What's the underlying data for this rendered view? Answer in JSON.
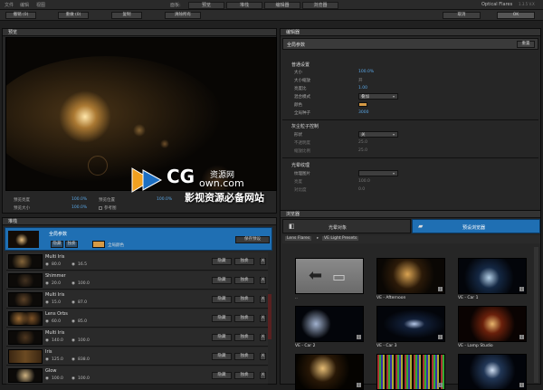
{
  "menu": {
    "file": "文件",
    "edit": "编辑",
    "view": "视图",
    "panels_label": "面板:"
  },
  "panel_tabs": [
    "预览",
    "堆栈",
    "编辑器",
    "浏览器"
  ],
  "app_title": "Optical Flares",
  "version": "1.3.5 V.X",
  "toolbar": {
    "undo": "撤销 (0)",
    "redo": "重做 (0)",
    "copy": "复制",
    "clear": "清除所有",
    "cancel": "取消",
    "ok": "OK"
  },
  "preview": {
    "title": "预览",
    "stats": [
      {
        "label": "预览亮度",
        "value": "100.0%"
      },
      {
        "label": "预览大小",
        "value": "100.0%"
      },
      {
        "label": "预览位置",
        "value": "100.0%"
      },
      {
        "label": "参考图",
        "value": ""
      }
    ]
  },
  "editor": {
    "title": "编辑器",
    "header": "全局参数",
    "header_btn": "重置",
    "global_section": "普通设置",
    "global_props": [
      {
        "label": "大小",
        "value": "100.0%"
      },
      {
        "label": "大小缩放",
        "value": "开"
      },
      {
        "label": "亮度比",
        "value": "1.00"
      },
      {
        "label": "混合模式",
        "value": "叠加"
      },
      {
        "label": "颜色",
        "value": ""
      },
      {
        "label": "全局种子",
        "value": "3000"
      }
    ],
    "dust_section": "灰尘粒子控制",
    "dust_props": [
      {
        "label": "形状",
        "value": "关"
      },
      {
        "label": "不透明度",
        "value": "25.0"
      },
      {
        "label": "缩放比例",
        "value": "25.0"
      }
    ],
    "texture_section": "光晕纹理",
    "texture_props": [
      {
        "label": "纹理图片",
        "value": ""
      },
      {
        "label": "亮度",
        "value": "100.0"
      },
      {
        "label": "对比度",
        "value": "0.0"
      }
    ]
  },
  "stack": {
    "title": "堆栈",
    "global": {
      "name": "全局参数",
      "btn1": "隐藏",
      "btn2": "独奏",
      "color_label": "全局颜色",
      "save": "保存预设"
    },
    "rows": [
      {
        "name": "Multi Iris",
        "v1": "80.0",
        "v2": "16.5"
      },
      {
        "name": "Shimmer",
        "v1": "20.0",
        "v2": "100.0"
      },
      {
        "name": "Multi Iris",
        "v1": "15.0",
        "v2": "87.0"
      },
      {
        "name": "Lens Orbs",
        "v1": "60.0",
        "v2": "85.0"
      },
      {
        "name": "Multi Iris",
        "v1": "140.0",
        "v2": "100.0"
      },
      {
        "name": "Iris",
        "v1": "125.0",
        "v2": "838.0"
      },
      {
        "name": "Glow",
        "v1": "100.0",
        "v2": "100.0"
      }
    ],
    "btn_hide": "隐藏",
    "btn_solo": "独奏",
    "btn_x": "X"
  },
  "browser": {
    "title": "浏览器",
    "tab1": "光晕对象",
    "tab2": "预设浏览器",
    "breadcrumb": [
      "Lens Flares",
      "VE Light Presets"
    ],
    "tiles": [
      {
        "label": ".."
      },
      {
        "label": "VE - Afternoon"
      },
      {
        "label": "VE - Car 1"
      },
      {
        "label": "VE - Car 2"
      },
      {
        "label": "VE - Car 3"
      },
      {
        "label": "VE - Lamp Studio"
      },
      {
        "label": ""
      },
      {
        "label": ""
      },
      {
        "label": ""
      }
    ]
  },
  "watermark": {
    "line1": "CG",
    "line2": "资源网",
    "line3": "own.com",
    "line4": "影视资源必备网站"
  },
  "colors": {
    "accent": "#1f6fb3",
    "value_blue": "#5aa7e6",
    "orange": "#e08a2b"
  }
}
